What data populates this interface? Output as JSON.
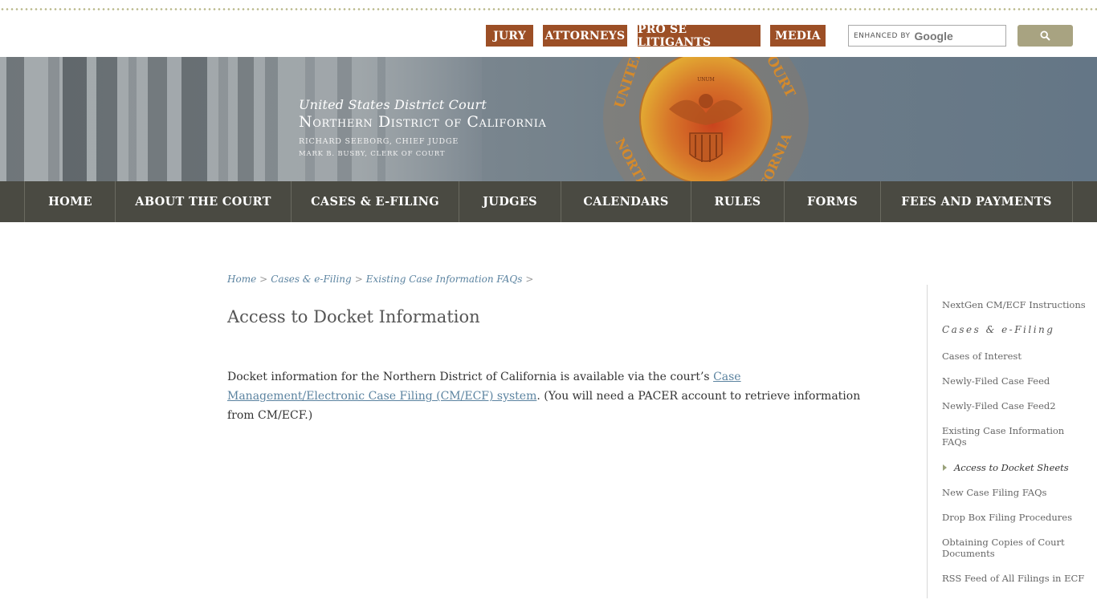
{
  "utility": {
    "links": [
      "JURY",
      "ATTORNEYS",
      "PRO SE LITIGANTS",
      "MEDIA"
    ],
    "search": {
      "enhanced_by": "ENHANCED BY",
      "google": "Google",
      "icon": "search-icon"
    }
  },
  "banner": {
    "court_line": "United States District Court",
    "district_line": "Northern District of California",
    "chief_judge": "Richard Seeborg, Chief Judge",
    "clerk": "Mark B. Busby, Clerk of Court",
    "seal_text_left": "UNITED",
    "seal_text_right": "COURT",
    "seal_text_bottom_left": "NORTH",
    "seal_text_bottom_right": "FORNIA",
    "seal_motto": "UNUM"
  },
  "nav": {
    "items": [
      "HOME",
      "ABOUT THE COURT",
      "CASES & E-FILING",
      "JUDGES",
      "CALENDARS",
      "RULES",
      "FORMS",
      "FEES AND PAYMENTS"
    ]
  },
  "breadcrumb": {
    "items": [
      "Home",
      "Cases & e-Filing",
      "Existing Case Information FAQs"
    ],
    "separator": ">"
  },
  "page": {
    "title": "Access to Docket Information",
    "text_before": "Docket information for the Northern District of California is available via the court’s ",
    "link_text": "Case Management/Electronic Case Filing (CM/ECF) system",
    "text_after": ". (You will need a PACER account to retrieve information from CM/ECF.)"
  },
  "sidebar": {
    "items": [
      "NextGen CM/ECF Instructions",
      "Cases & e-Filing",
      "Cases of Interest",
      "Newly-Filed Case Feed",
      "Newly-Filed Case Feed2",
      "Existing Case Information FAQs",
      "Access to Docket Sheets",
      "New Case Filing FAQs",
      "Drop Box Filing Procedures",
      "Obtaining Copies of Court Documents",
      "RSS Feed of All Filings in ECF"
    ]
  },
  "colors": {
    "util_button": "#9c4f26",
    "nav_bg": "#4a4a42",
    "link": "#5b83a0"
  }
}
